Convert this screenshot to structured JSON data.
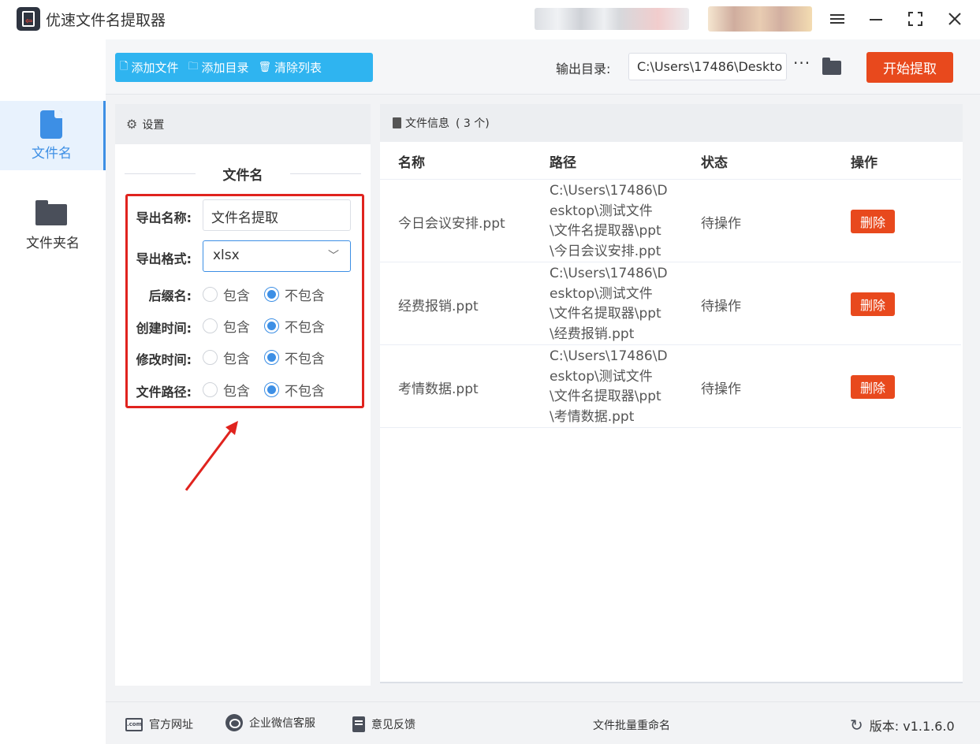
{
  "app": {
    "title": "优速文件名提取器"
  },
  "sidebar": {
    "items": [
      {
        "label": "文件名",
        "icon": "file-icon",
        "active": true
      },
      {
        "label": "文件夹名",
        "icon": "folder-icon",
        "active": false
      }
    ]
  },
  "toolbar": {
    "add_file": "添加文件",
    "add_dir": "添加目录",
    "clear_list": "清除列表",
    "output_label": "输出目录:",
    "output_path": "C:\\Users\\17486\\Deskto",
    "more": "···",
    "start": "开始提取"
  },
  "settings": {
    "header": "设置",
    "section_title": "文件名",
    "export_name_label": "导出名称:",
    "export_name_value": "文件名提取",
    "export_format_label": "导出格式:",
    "export_format_value": "xlsx",
    "options": [
      {
        "label": "后缀名:",
        "include": "包含",
        "exclude": "不包含",
        "selected": "exclude"
      },
      {
        "label": "创建时间:",
        "include": "包含",
        "exclude": "不包含",
        "selected": "exclude"
      },
      {
        "label": "修改时间:",
        "include": "包含",
        "exclude": "不包含",
        "selected": "exclude"
      },
      {
        "label": "文件路径:",
        "include": "包含",
        "exclude": "不包含",
        "selected": "exclude"
      }
    ]
  },
  "fileinfo": {
    "header": "文件信息",
    "count": "( 3 个)",
    "columns": [
      "名称",
      "路径",
      "状态",
      "操作"
    ],
    "rows": [
      {
        "name": "今日会议安排.ppt",
        "path": "C:\\Users\\17486\\Desktop\\测试文件\\文件名提取器\\ppt\\今日会议安排.ppt",
        "status": "待操作",
        "action": "删除"
      },
      {
        "name": "经费报销.ppt",
        "path": "C:\\Users\\17486\\Desktop\\测试文件\\文件名提取器\\ppt\\经费报销.ppt",
        "status": "待操作",
        "action": "删除"
      },
      {
        "name": "考情数据.ppt",
        "path": "C:\\Users\\17486\\Desktop\\测试文件\\文件名提取器\\ppt\\考情数据.ppt",
        "status": "待操作",
        "action": "删除"
      }
    ]
  },
  "footer": {
    "website": "官方网址",
    "wechat": "企业微信客服",
    "feedback": "意见反馈",
    "center": "文件批量重命名",
    "version": "版本: v1.1.6.0"
  },
  "colors": {
    "accent": "#3d8fe5",
    "toolbar_btn": "#2fb4f0",
    "primary_action": "#e8491d",
    "highlight": "#e0231e"
  }
}
